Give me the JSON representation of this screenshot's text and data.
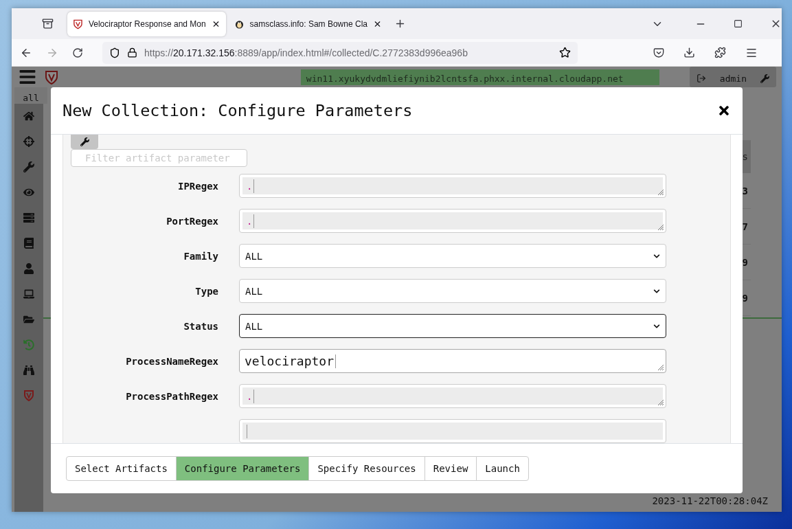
{
  "browser": {
    "tabs": [
      {
        "title": "Velociraptor Response and Mon",
        "selected": true,
        "kind": "raptor"
      },
      {
        "title": "samsclass.info: Sam Bowne Cla",
        "selected": false,
        "kind": "penguin"
      }
    ],
    "url": {
      "scheme": "https://",
      "host": "20.171.32.156",
      "path": ":8889/app/index.html#/collected/C.2772383d996ea96b"
    }
  },
  "app": {
    "hostname": "win11.xyukydvdmliefiynib2lcntsfa.phxx.internal.cloudapp.net",
    "user": "admin",
    "tab": "all",
    "sidebar": [
      {
        "kind": "home",
        "selected": false
      },
      {
        "kind": "crosshairs",
        "selected": false
      },
      {
        "kind": "wrench",
        "selected": false
      },
      {
        "kind": "eye",
        "selected": false
      },
      {
        "kind": "server",
        "selected": false
      },
      {
        "kind": "book",
        "selected": false
      },
      {
        "kind": "user",
        "selected": false
      },
      {
        "kind": "laptop",
        "selected": false
      },
      {
        "kind": "folder",
        "selected": false
      },
      {
        "kind": "history",
        "selected": true
      },
      {
        "kind": "binoculars",
        "selected": false
      },
      {
        "kind": "shield",
        "selected": false
      }
    ],
    "table": {
      "column_1": "s",
      "cells": [
        "3",
        "7",
        "9",
        "9"
      ]
    },
    "timestamp": "2023-11-22T00:28:04Z"
  },
  "dialog": {
    "title": "New Collection: Configure Parameters",
    "filter": {
      "placeholder": "Filter artifact parameter"
    },
    "parameters": [
      {
        "label": "IPRegex",
        "kind": "textarea",
        "value": ".",
        "focused": false
      },
      {
        "label": "PortRegex",
        "kind": "textarea",
        "value": ".",
        "focused": false
      },
      {
        "label": "Family",
        "kind": "select",
        "value": "ALL",
        "focused": false
      },
      {
        "label": "Type",
        "kind": "select",
        "value": "ALL",
        "focused": false
      },
      {
        "label": "Status",
        "kind": "select",
        "value": "ALL",
        "focused": true
      },
      {
        "label": "ProcessNameRegex",
        "kind": "textarea",
        "value": "velociraptor",
        "focused": true
      },
      {
        "label": "ProcessPathRegex",
        "kind": "textarea",
        "value": ".",
        "focused": false
      },
      {
        "kind": "textarea",
        "focused": false
      }
    ],
    "steps": [
      {
        "label": "Select Artifacts",
        "selected": false
      },
      {
        "label": "Configure Parameters",
        "selected": true
      },
      {
        "label": "Specify Resources",
        "selected": false
      },
      {
        "label": "Review",
        "selected": false
      },
      {
        "label": "Launch",
        "selected": false
      }
    ]
  }
}
